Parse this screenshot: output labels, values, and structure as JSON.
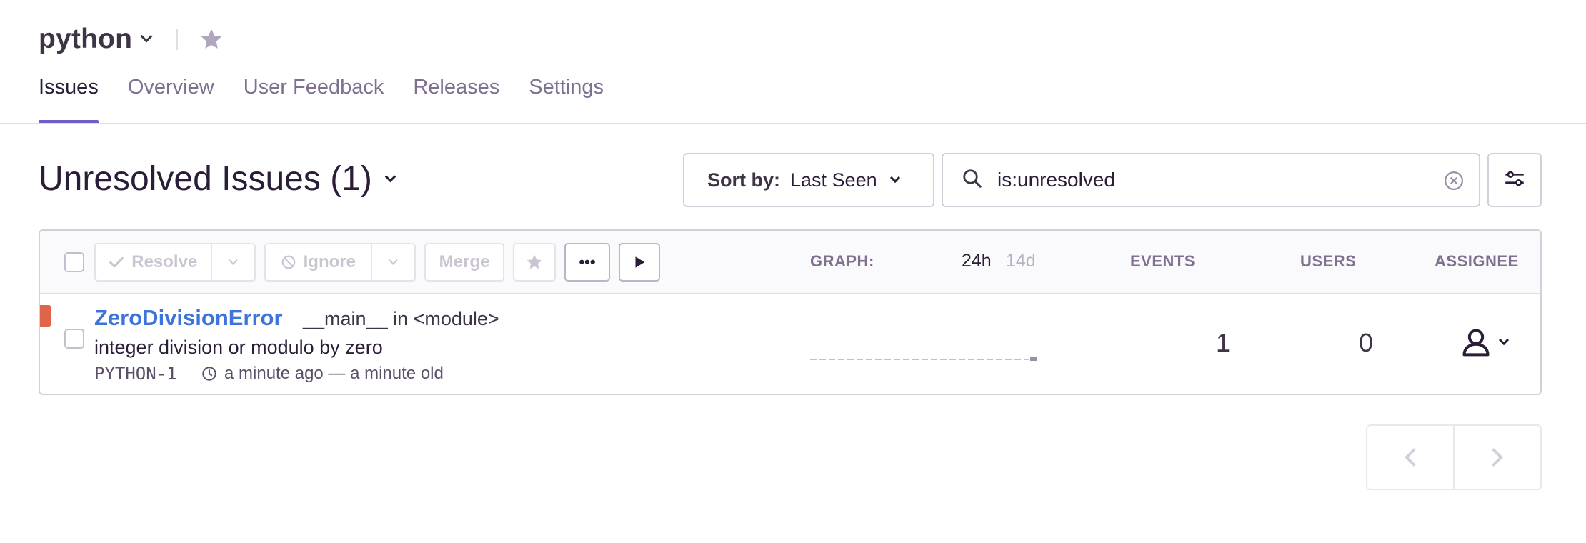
{
  "project": {
    "name": "python"
  },
  "tabs": [
    {
      "label": "Issues",
      "active": true
    },
    {
      "label": "Overview",
      "active": false
    },
    {
      "label": "User Feedback",
      "active": false
    },
    {
      "label": "Releases",
      "active": false
    },
    {
      "label": "Settings",
      "active": false
    }
  ],
  "issues_view": {
    "title": "Unresolved Issues (1)",
    "sort_label": "Sort by:",
    "sort_value": "Last Seen",
    "search_query": "is:unresolved"
  },
  "toolbar": {
    "resolve_label": "Resolve",
    "ignore_label": "Ignore",
    "merge_label": "Merge",
    "more_label": "•••"
  },
  "columns": {
    "graph_label": "GRAPH:",
    "period_24h": "24h",
    "period_14d": "14d",
    "events": "EVENTS",
    "users": "USERS",
    "assignee": "ASSIGNEE"
  },
  "issues": [
    {
      "title": "ZeroDivisionError",
      "location": "__main__ in <module>",
      "message": "integer division or modulo by zero",
      "short_id": "PYTHON-1",
      "time": "a minute ago — a minute old",
      "events": "1",
      "users": "0",
      "level_color": "#e0644a"
    }
  ],
  "colors": {
    "accent": "#6c5fc7",
    "link": "#3d74db",
    "error_level": "#e0644a"
  },
  "icons": [
    "chevron-down-icon",
    "star-icon",
    "search-icon",
    "clear-icon",
    "filter-sliders-icon",
    "check-icon",
    "ignore-icon",
    "play-icon",
    "clock-icon",
    "user-icon",
    "chevron-left-icon",
    "chevron-right-icon"
  ]
}
